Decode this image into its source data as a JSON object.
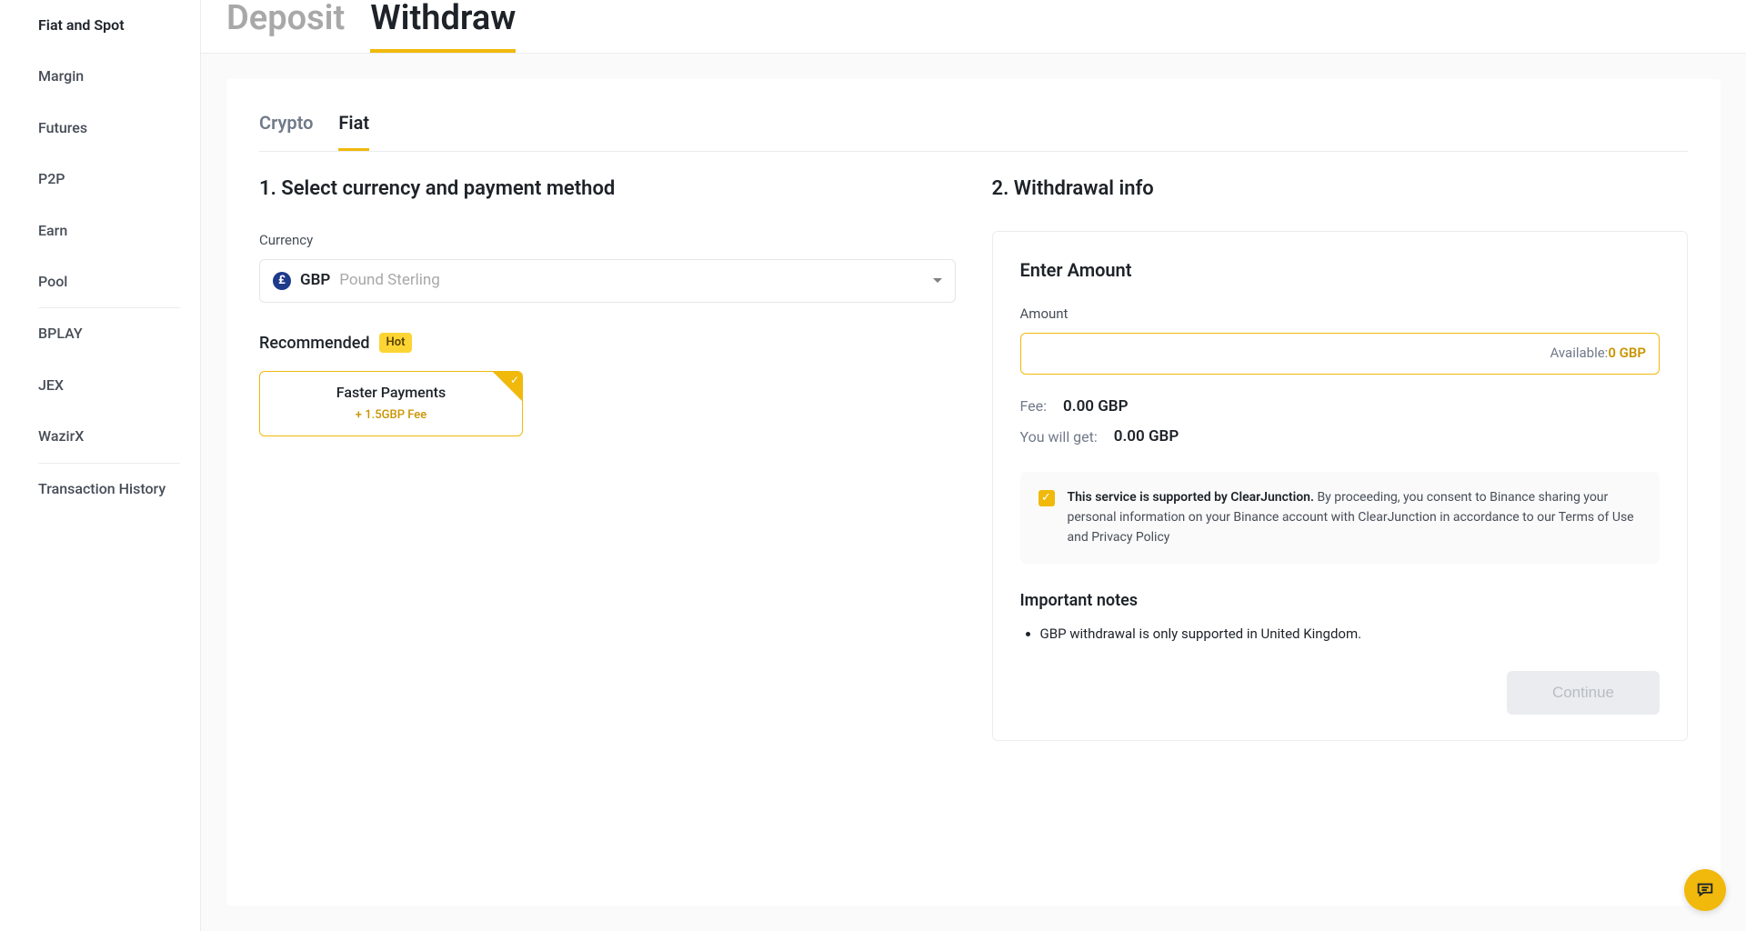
{
  "sidebar": {
    "items": [
      {
        "label": "Fiat and Spot",
        "active": true
      },
      {
        "label": "Margin"
      },
      {
        "label": "Futures"
      },
      {
        "label": "P2P"
      },
      {
        "label": "Earn"
      },
      {
        "label": "Pool"
      },
      {
        "label": "BPLAY"
      },
      {
        "label": "JEX"
      },
      {
        "label": "WazirX"
      },
      {
        "label": "Transaction History"
      }
    ]
  },
  "top_tabs": {
    "deposit": "Deposit",
    "withdraw": "Withdraw"
  },
  "sub_tabs": {
    "crypto": "Crypto",
    "fiat": "Fiat"
  },
  "step1": {
    "title": "1. Select currency and payment method",
    "currency_label": "Currency",
    "currency": {
      "symbol": "£",
      "code": "GBP",
      "name": "Pound Sterling"
    },
    "recommended_label": "Recommended",
    "hot_badge": "Hot",
    "method": {
      "name": "Faster Payments",
      "fee": "+ 1.5GBP Fee"
    }
  },
  "step2": {
    "title": "2. Withdrawal info",
    "enter_amount": "Enter Amount",
    "amount_label": "Amount",
    "available_label": "Available: ",
    "available_value": "0 GBP",
    "fee_label": "Fee:",
    "fee_value": "0.00 GBP",
    "get_label": "You will get:",
    "get_value": "0.00 GBP",
    "consent_bold": "This service is supported by ClearJunction.",
    "consent_rest": " By proceeding, you consent to Binance sharing your personal information on your Binance account with ClearJunction in accordance to our Terms of Use and Privacy Policy",
    "notes_title": "Important notes",
    "notes": [
      "GBP withdrawal is only supported in United Kingdom."
    ],
    "continue": "Continue"
  }
}
